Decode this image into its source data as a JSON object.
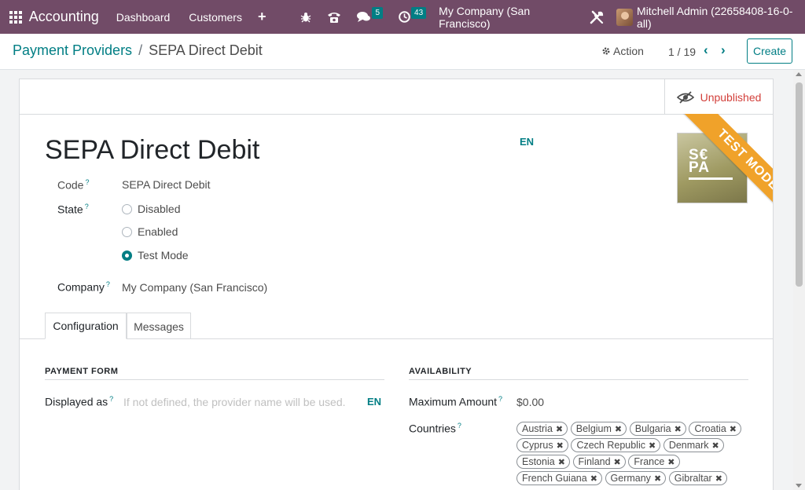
{
  "navbar": {
    "app_name": "Accounting",
    "menus": [
      "Dashboard",
      "Customers"
    ],
    "plus_label": "+",
    "messages_count": "5",
    "activities_count": "43",
    "company": "My Company (San Francisco)",
    "user": "Mitchell Admin (22658408-16-0-all)"
  },
  "breadcrumb": {
    "parent": "Payment Providers",
    "separator": "/",
    "current": "SEPA Direct Debit"
  },
  "control": {
    "action_label": "Action",
    "pager": "1 / 19",
    "prev": "‹",
    "next": "›",
    "create_label": "Create"
  },
  "form": {
    "publish_label": "Unpublished",
    "title": "SEPA Direct Debit",
    "title_lang": "EN",
    "ribbon": "TEST MODE",
    "logo_text": "S€\nPA",
    "code_label": "Code",
    "code_value": "SEPA Direct Debit",
    "state_label": "State",
    "states": [
      {
        "label": "Disabled",
        "checked": false
      },
      {
        "label": "Enabled",
        "checked": false
      },
      {
        "label": "Test Mode",
        "checked": true
      }
    ],
    "company_label": "Company",
    "company_value": "My Company (San Francisco)",
    "tooltip_mark": "?"
  },
  "tabs": [
    {
      "label": "Configuration",
      "active": true
    },
    {
      "label": "Messages",
      "active": false
    }
  ],
  "payment_form": {
    "section_title": "PAYMENT FORM",
    "displayed_as_label": "Displayed as",
    "displayed_as_placeholder": "If not defined, the provider name will be used.",
    "lang": "EN"
  },
  "availability": {
    "section_title": "AVAILABILITY",
    "max_amount_label": "Maximum Amount",
    "max_amount_value": "$0.00",
    "countries_label": "Countries",
    "countries": [
      "Austria",
      "Belgium",
      "Bulgaria",
      "Croatia",
      "Cyprus",
      "Czech Republic",
      "Denmark",
      "Estonia",
      "Finland",
      "France",
      "French Guiana",
      "Germany",
      "Gibraltar"
    ]
  },
  "colors": {
    "brand": "#714b67",
    "accent": "#017e84",
    "ribbon": "#f0a22a",
    "unpublished": "#d23f3a"
  },
  "icons": [
    "apps-grid-icon",
    "bug-icon",
    "phone-icon",
    "chat-icon",
    "clock-icon",
    "tools-icon",
    "gear-icon",
    "eye-slash-icon",
    "remove-tag-icon"
  ]
}
